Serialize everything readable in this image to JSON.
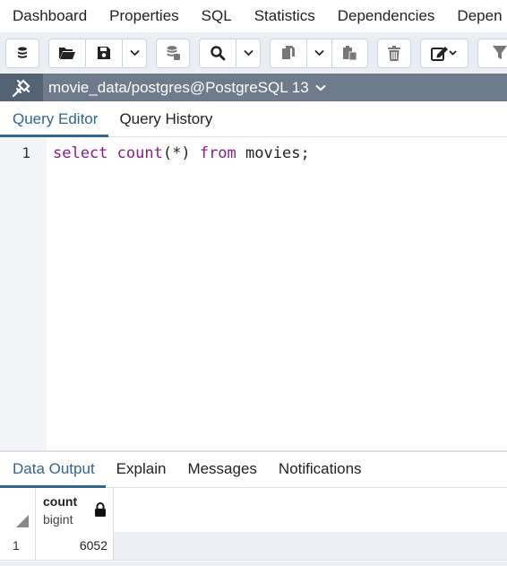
{
  "top_tabs": [
    "Dashboard",
    "Properties",
    "SQL",
    "Statistics",
    "Dependencies",
    "Depen"
  ],
  "toolbar": {
    "buttons": [
      "execute-options-icon",
      "open-file-icon",
      "save-icon",
      "chevron-down-icon",
      "database-icon",
      "search-icon",
      "chevron-down-icon",
      "copy-icon",
      "chevron-down-icon",
      "paste-icon",
      "delete-icon",
      "edit-icon",
      "filter-icon"
    ]
  },
  "connection": {
    "label": "movie_data/postgres@PostgreSQL 13",
    "icon": "connection-plug-icon"
  },
  "editor_tabs": {
    "query_editor": "Query Editor",
    "query_history": "Query History"
  },
  "editor": {
    "line_number": "1",
    "tokens": {
      "select": "select",
      "count": "count",
      "args": "(*)",
      "from": "from",
      "table": "movies;"
    }
  },
  "output_tabs": {
    "data_output": "Data Output",
    "explain": "Explain",
    "messages": "Messages",
    "notifications": "Notifications"
  },
  "grid": {
    "column_name": "count",
    "column_type": "bigint",
    "rows": [
      {
        "row_number": "1",
        "count": "6052"
      }
    ]
  },
  "colors": {
    "accent": "#326690",
    "connection_bar": "#6d7b8c",
    "keyword": "#8a1c88"
  }
}
